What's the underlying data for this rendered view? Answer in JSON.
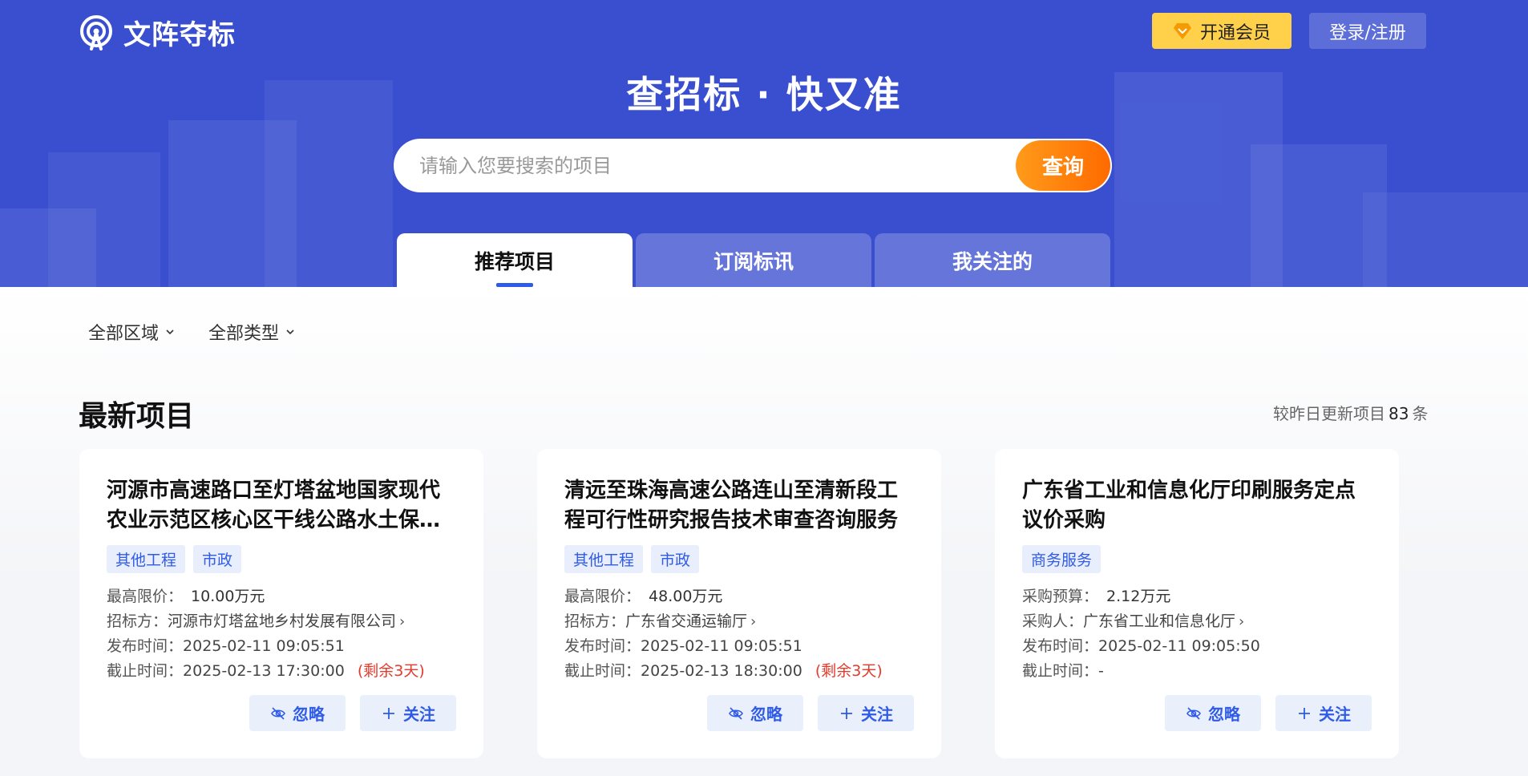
{
  "header": {
    "logo_text": "文阵夺标",
    "vip_label": "开通会员",
    "login_label": "登录/注册",
    "slogan": "查招标 · 快又准"
  },
  "search": {
    "placeholder": "请输入您要搜索的项目",
    "button_label": "查询"
  },
  "tabs": [
    {
      "label": "推荐项目",
      "active": true
    },
    {
      "label": "订阅标讯",
      "active": false
    },
    {
      "label": "我关注的",
      "active": false
    }
  ],
  "filters": {
    "region_label": "全部区域",
    "type_label": "全部类型"
  },
  "section": {
    "title": "最新项目",
    "update_prefix": "较昨日更新项目",
    "update_count": "83",
    "update_suffix": "条"
  },
  "actions": {
    "ignore_label": "忽略",
    "follow_label": "关注"
  },
  "cards": [
    {
      "title": "河源市高速路口至灯塔盆地国家现代农业示范区核心区干线公路水土保持设施验收技术服务",
      "tags": [
        "其他工程",
        "市政"
      ],
      "price_label": "最高限价：",
      "price": "10.00万元",
      "org_label": "招标方：",
      "org": "河源市灯塔盆地乡村发展有限公司",
      "publish_label": "发布时间：",
      "publish_time": "2025-02-11 09:05:51",
      "deadline_label": "截止时间：",
      "deadline": "2025-02-13 17:30:00",
      "remain": "(剩余3天)"
    },
    {
      "title": "清远至珠海高速公路连山至清新段工程可行性研究报告技术审查咨询服务",
      "tags": [
        "其他工程",
        "市政"
      ],
      "price_label": "最高限价：",
      "price": "48.00万元",
      "org_label": "招标方：",
      "org": "广东省交通运输厅",
      "publish_label": "发布时间：",
      "publish_time": "2025-02-11 09:05:51",
      "deadline_label": "截止时间：",
      "deadline": "2025-02-13 18:30:00",
      "remain": "(剩余3天)"
    },
    {
      "title": "广东省工业和信息化厅印刷服务定点议价采购",
      "tags": [
        "商务服务"
      ],
      "price_label": "采购预算：",
      "price": "2.12万元",
      "org_label": "采购人：",
      "org": "广东省工业和信息化厅",
      "publish_label": "发布时间：",
      "publish_time": "2025-02-11 09:05:50",
      "deadline_label": "截止时间：",
      "deadline": "-",
      "remain": ""
    }
  ],
  "colors": {
    "brand_blue": "#3a4fd0",
    "accent_orange": "#ff7a0a",
    "vip_yellow": "#ffd04a",
    "tag_blue": "#2f5be6",
    "remain_red": "#e23b2d"
  },
  "icons": {
    "logo": "signal-tower-icon",
    "vip": "diamond-icon",
    "ignore": "eye-off-icon",
    "follow": "plus-icon",
    "dropdown": "chevron-down-icon",
    "org_link": "chevron-right-icon"
  }
}
